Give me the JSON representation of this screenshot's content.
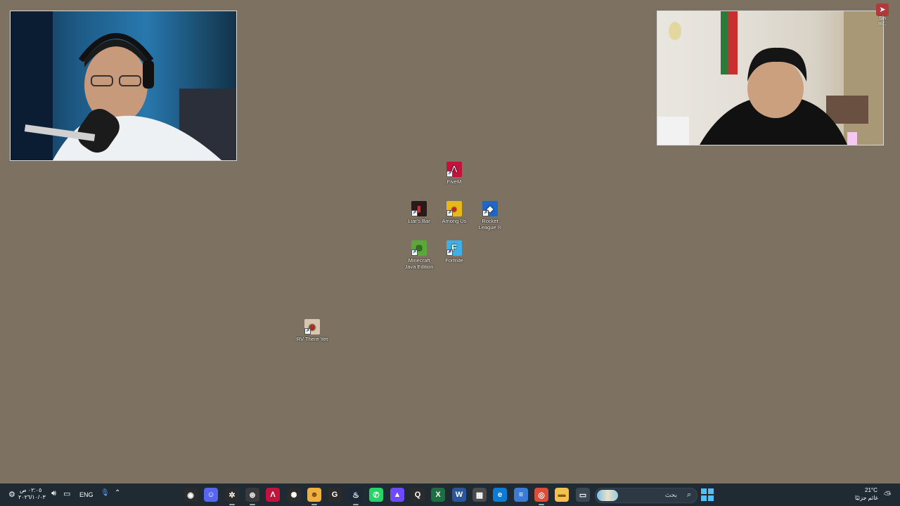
{
  "desktop": {
    "background": "#7d7261",
    "icons": [
      {
        "label": "FiveM",
        "color": "#c0143c",
        "glyph": "Λ"
      },
      {
        "label": "Liar's Bar",
        "color": "#2a1a1a",
        "glyph": "▮"
      },
      {
        "label": "Among Us",
        "color": "#e8b818",
        "glyph": "●"
      },
      {
        "label": "Rocket\nLeague ®",
        "color": "#1f66c8",
        "glyph": "◆"
      },
      {
        "label": "Minecraft\nJava Edition",
        "color": "#5aa83a",
        "glyph": "■"
      },
      {
        "label": "Fortnite",
        "color": "#3fb0e6",
        "glyph": "F"
      },
      {
        "label": "RV There Yet",
        "color": "#d8c6b0",
        "glyph": "☻"
      }
    ]
  },
  "notification": {
    "label_top": "Sin",
    "label_bottom": "m..."
  },
  "taskbar": {
    "background": "#1f2a33",
    "clock_time": "٠٢:٠٥ ص",
    "clock_date": "٢٠٢٦/١٠/٠٣",
    "language": "ENG",
    "search_placeholder": "بحث",
    "weather_temp": "21°C",
    "weather_desc": "غائم جزئيًا",
    "pinned_apps": [
      {
        "name": "obs-icon",
        "color": "#2b2b2b",
        "glyph": "◉"
      },
      {
        "name": "discord-icon",
        "color": "#5865f2",
        "glyph": "☺"
      },
      {
        "name": "steelseries-icon",
        "color": "#2b2b2b",
        "glyph": "✲"
      },
      {
        "name": "rockstar-icon",
        "color": "#3a3a3a",
        "glyph": "⊛"
      },
      {
        "name": "fivem-icon",
        "color": "#c0143c",
        "glyph": "Λ"
      },
      {
        "name": "chatgpt-icon",
        "color": "#2b2b2b",
        "glyph": "✺"
      },
      {
        "name": "messenger-app-icon",
        "color": "#f0b040",
        "glyph": "☻"
      },
      {
        "name": "g-hub-icon",
        "color": "#2b2b2b",
        "glyph": "G"
      },
      {
        "name": "steam-icon",
        "color": "#1b2838",
        "glyph": "♨"
      },
      {
        "name": "whatsapp-icon",
        "color": "#25d366",
        "glyph": "✆"
      },
      {
        "name": "proton-vpn-icon",
        "color": "#6d4aff",
        "glyph": "▲"
      },
      {
        "name": "qbittorrent-icon",
        "color": "#2b2b2b",
        "glyph": "Q"
      },
      {
        "name": "excel-icon",
        "color": "#1d6f42",
        "glyph": "X"
      },
      {
        "name": "word-icon",
        "color": "#2b579a",
        "glyph": "W"
      },
      {
        "name": "store-icon",
        "color": "#4b4b4b",
        "glyph": "▦"
      },
      {
        "name": "edge-icon",
        "color": "#0c7bd6",
        "glyph": "e"
      },
      {
        "name": "notepad-icon",
        "color": "#3a7bd5",
        "glyph": "≡"
      },
      {
        "name": "chrome-icon",
        "color": "#dd4b39",
        "glyph": "◎"
      },
      {
        "name": "file-explorer-icon",
        "color": "#f2c14e",
        "glyph": "▬"
      },
      {
        "name": "task-view-icon",
        "color": "#3a4853",
        "glyph": "▭"
      }
    ]
  }
}
